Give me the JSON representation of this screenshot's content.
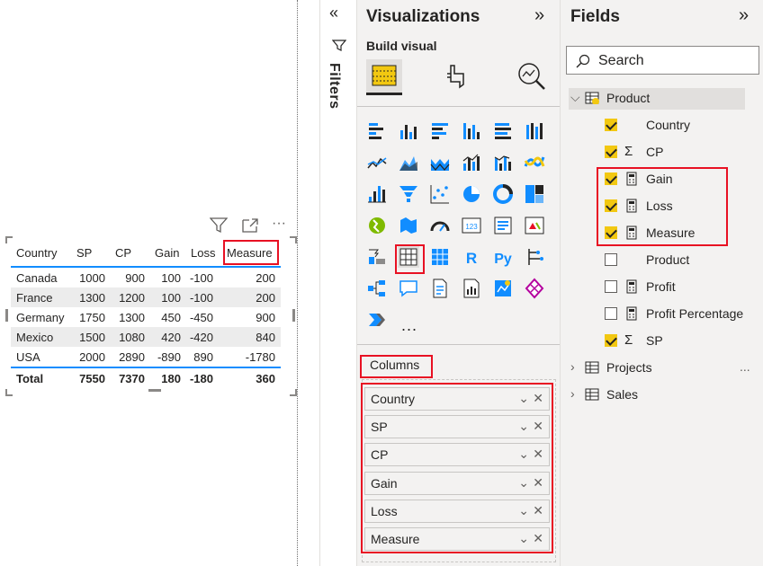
{
  "filters": {
    "label": "Filters"
  },
  "table": {
    "headers": [
      "Country",
      "SP",
      "CP",
      "Gain",
      "Loss",
      "Measure"
    ],
    "rows": [
      [
        "Canada",
        "1000",
        "900",
        "100",
        "-100",
        "200"
      ],
      [
        "France",
        "1300",
        "1200",
        "100",
        "-100",
        "200"
      ],
      [
        "Germany",
        "1750",
        "1300",
        "450",
        "-450",
        "900"
      ],
      [
        "Mexico",
        "1500",
        "1080",
        "420",
        "-420",
        "840"
      ],
      [
        "USA",
        "2000",
        "2890",
        "-890",
        "890",
        "-1780"
      ]
    ],
    "total": [
      "Total",
      "7550",
      "7370",
      "180",
      "-180",
      "360"
    ]
  },
  "visualizations": {
    "title": "Visualizations",
    "build_visual": "Build visual",
    "well_label": "Columns",
    "wells": [
      "Country",
      "SP",
      "CP",
      "Gain",
      "Loss",
      "Measure"
    ],
    "more": "..."
  },
  "fields": {
    "title": "Fields",
    "search_placeholder": "Search",
    "tables": [
      {
        "name": "Product",
        "expanded": true
      },
      {
        "name": "Projects",
        "expanded": false
      },
      {
        "name": "Sales",
        "expanded": false
      }
    ],
    "product_fields": [
      {
        "name": "Country",
        "checked": true,
        "icon": "none"
      },
      {
        "name": "CP",
        "checked": true,
        "icon": "sigma"
      },
      {
        "name": "Gain",
        "checked": true,
        "icon": "calc"
      },
      {
        "name": "Loss",
        "checked": true,
        "icon": "calc"
      },
      {
        "name": "Measure",
        "checked": true,
        "icon": "calc"
      },
      {
        "name": "Product",
        "checked": false,
        "icon": "none"
      },
      {
        "name": "Profit",
        "checked": false,
        "icon": "calc"
      },
      {
        "name": "Profit Percentage",
        "checked": false,
        "icon": "calc"
      },
      {
        "name": "SP",
        "checked": true,
        "icon": "sigma"
      }
    ],
    "more": "..."
  },
  "colors": {
    "accent": "#f2c811",
    "highlight": "#e81123",
    "chart_blue": "#118dff"
  }
}
